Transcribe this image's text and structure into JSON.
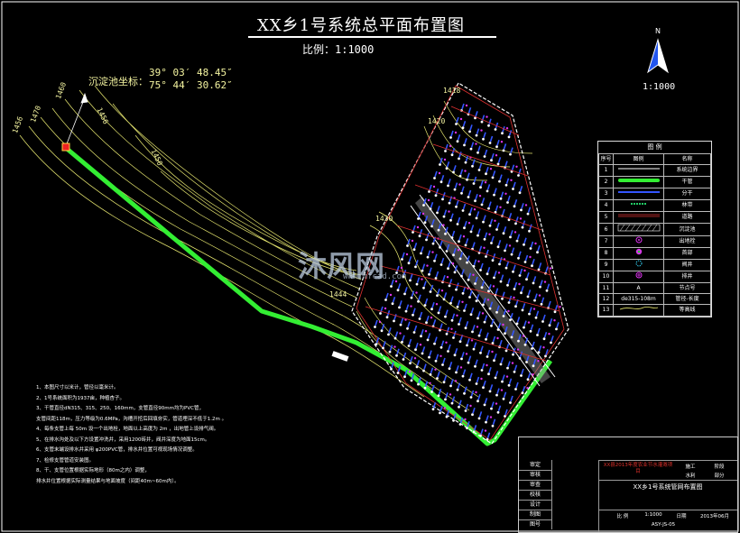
{
  "title": "XX乡1号系统总平面布置图",
  "scale_text": "比例：1:1000",
  "coordinates": {
    "label": "沉淀池坐标：",
    "lat": "39° 03′ 48.45″",
    "lon": "75° 44′ 30.62″"
  },
  "north": {
    "letter": "N",
    "scale": "1:1000"
  },
  "contour_labels": [
    "1460",
    "1470",
    "1456",
    "1456",
    "1450",
    "1418",
    "1420",
    "1430",
    "1444"
  ],
  "watermark": {
    "text": "沐风网",
    "url": "www.mfcad.com"
  },
  "legend": {
    "title": "图 例",
    "headers": [
      "序号",
      "图例",
      "名称"
    ],
    "rows": [
      {
        "no": "1",
        "name": "系统边界"
      },
      {
        "no": "2",
        "name": "干管"
      },
      {
        "no": "3",
        "name": "分干"
      },
      {
        "no": "4",
        "name": "林带"
      },
      {
        "no": "5",
        "name": "道路"
      },
      {
        "no": "6",
        "name": "沉淀池"
      },
      {
        "no": "7",
        "name": "出地栓"
      },
      {
        "no": "8",
        "name": "首部"
      },
      {
        "no": "9",
        "name": "阀井"
      },
      {
        "no": "10",
        "name": "排井"
      },
      {
        "no": "11",
        "symbol": "A",
        "name": "节点号"
      },
      {
        "no": "12",
        "symbol": "de315-108m",
        "name": "管径-长度"
      },
      {
        "no": "13",
        "name": "等高线"
      }
    ],
    "colors": {
      "boundary": "#ffffff",
      "main_pipe": "#33ee33",
      "branch": "#3355ff",
      "forest": "#22cc66",
      "road": "#dd3030",
      "valve": "#dd33ee",
      "contour": "#e8e870"
    }
  },
  "notes": [
    "1、本图尺寸以米计，管径以毫米计。",
    "2、1号系统面积为1937亩，种植杏子。",
    "3、干管直径dN315、315、250、160mm，支管直径90mm均为PVC管，",
    "   支管间距118m，压力等级为0.6MPa，沟槽开挖后回填夯实，管道埋深不低于1.2m 。",
    "4、每条支管上每 50m 设一个出地栓，地面以上高度为 2m ，出地管上设排气阀。",
    "5、在排水沟处及以下方设置冲洗井，采用1200砖井，阀井深度为地面15cm。",
    "6、支管末端设排水井采用 φ200PVC管，排水井位置可视现场情况调整。",
    "7、检修支管管道安装图。",
    "8、干、支管位置根据实际地形（80m之内）调整，",
    "   排水井位置根据实际测量结果与地面坡度（间距40m~60m内）。"
  ],
  "title_block": {
    "left_labels": [
      "审定",
      "审核",
      "审查",
      "校核",
      "设计",
      "制图",
      "比例",
      "图号"
    ],
    "project_red": "XX县2013年度农业节水灌溉项目",
    "stage": "施工",
    "specialty": "水利",
    "stage_label": "阶段",
    "specialty_label": "部分",
    "drawing_title": "XX乡1号系统管网布置图",
    "scale_label": "比 例",
    "scale_value": "1:1000",
    "date_label": "日期",
    "date_value": "2013年06月",
    "drawing_no": "ASY-JS-05"
  }
}
